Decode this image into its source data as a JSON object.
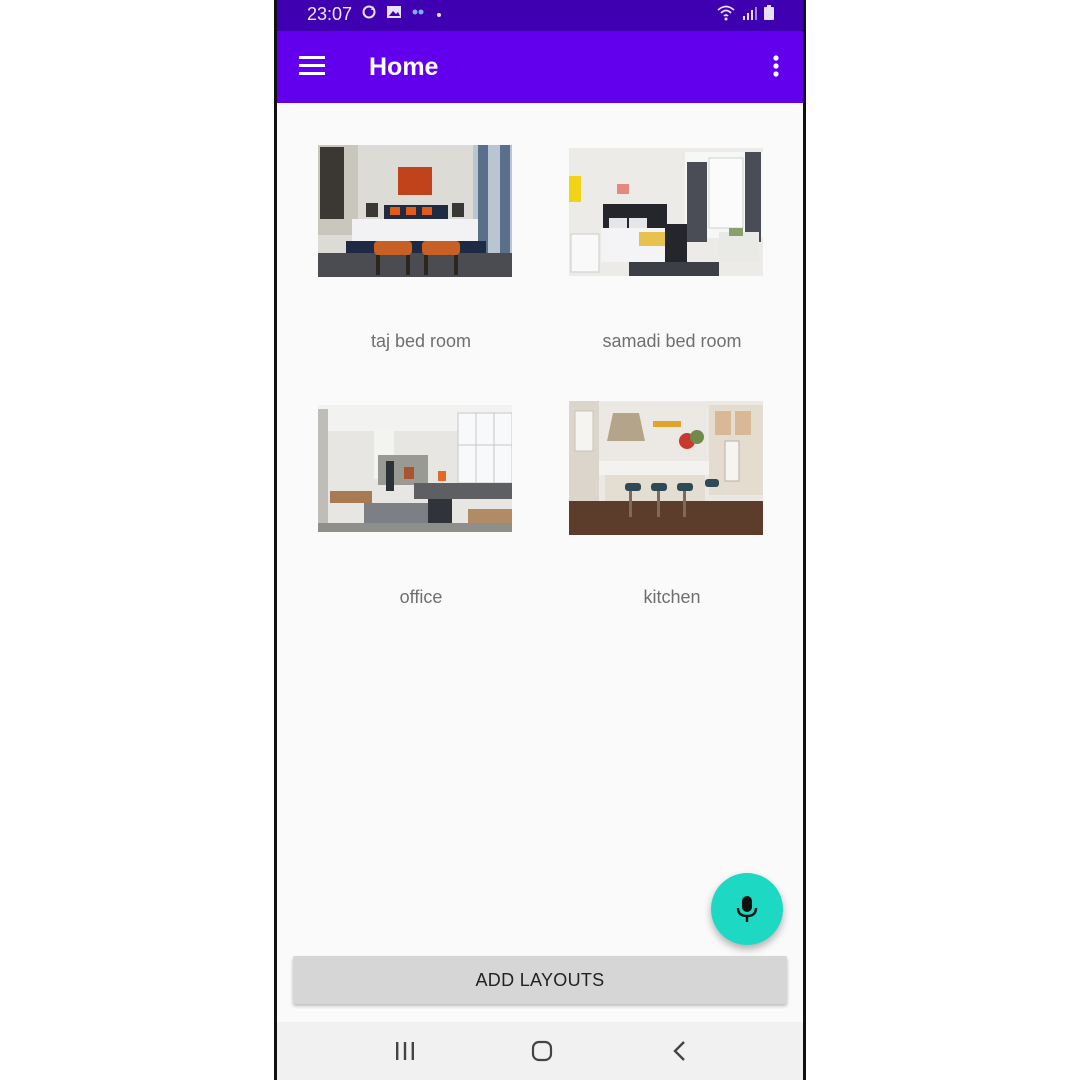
{
  "status_bar": {
    "time": "23:07",
    "icons": [
      "sync-icon",
      "image-icon",
      "quote-icon",
      "dot-icon",
      "wifi-icon",
      "signal-icon",
      "battery-icon"
    ]
  },
  "app_bar": {
    "title": "Home",
    "left_icon": "menu-icon",
    "right_icon": "more-vert-icon",
    "color": "#6200ee",
    "status_color": "#3e00b0"
  },
  "layouts": [
    {
      "label": "taj bed room"
    },
    {
      "label": "samadi bed room"
    },
    {
      "label": "office"
    },
    {
      "label": "kitchen"
    }
  ],
  "fab": {
    "icon": "mic-icon",
    "color": "#1dd9c4"
  },
  "actions": {
    "add_layouts_label": "ADD LAYOUTS"
  },
  "nav_bar": {
    "buttons": [
      "recents-icon",
      "home-icon",
      "back-icon"
    ]
  }
}
